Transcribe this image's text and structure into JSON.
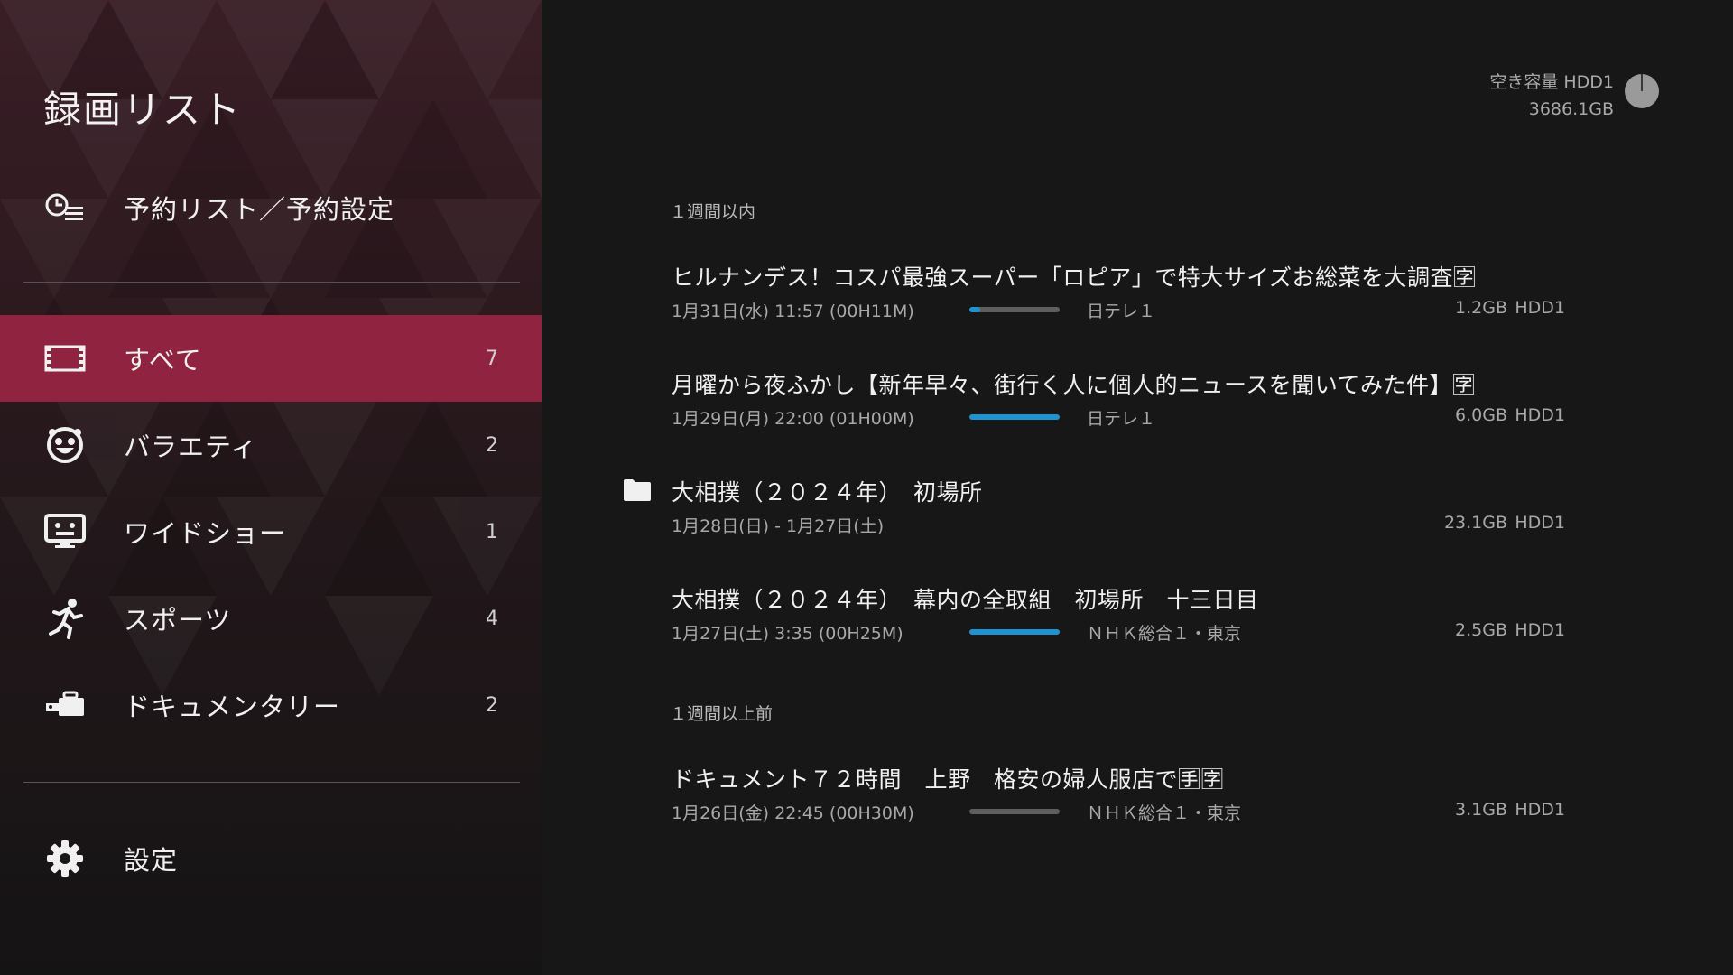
{
  "sidebar": {
    "title": "録画リスト",
    "schedule_label": "予約リスト／予約設定",
    "categories": [
      {
        "label": "すべて",
        "count": "7",
        "icon": "film-icon",
        "active": true
      },
      {
        "label": "バラエティ",
        "count": "2",
        "icon": "smiley-face-icon",
        "active": false
      },
      {
        "label": "ワイドショー",
        "count": "1",
        "icon": "tv-face-icon",
        "active": false
      },
      {
        "label": "スポーツ",
        "count": "4",
        "icon": "running-person-icon",
        "active": false
      },
      {
        "label": "ドキュメンタリー",
        "count": "2",
        "icon": "video-camera-icon",
        "active": false
      }
    ],
    "settings_label": "設定"
  },
  "storage": {
    "label": "空き容量 HDD1",
    "value": "3686.1GB"
  },
  "sections": [
    {
      "header": "１週間以内",
      "items": [
        {
          "title": "ヒルナンデス！コスパ最強スーパー「ロピア」で特大サイズお総菜を大調査🈑",
          "date": "1月31日(水) 11:57 (00H11M)",
          "progress": 0.12,
          "channel": "日テレ１",
          "size": "1.2GB",
          "drive": "HDD1",
          "folder": false
        },
        {
          "title": "月曜から夜ふかし【新年早々、街行く人に個人的ニュースを聞いてみた件】🈑",
          "date": "1月29日(月) 22:00 (01H00M)",
          "progress": 1.0,
          "channel": "日テレ１",
          "size": "6.0GB",
          "drive": "HDD1",
          "folder": false
        },
        {
          "title": "大相撲（２０２４年）　初場所",
          "date": "1月28日(日) - 1月27日(土)",
          "progress": null,
          "channel": "",
          "size": "23.1GB",
          "drive": "HDD1",
          "folder": true
        },
        {
          "title": "大相撲（２０２４年）　幕内の全取組　初場所　十三日目",
          "date": "1月27日(土) 3:35 (00H25M)",
          "progress": 1.0,
          "channel": "ＮＨＫ総合１・東京",
          "size": "2.5GB",
          "drive": "HDD1",
          "folder": false
        }
      ]
    },
    {
      "header": "１週間以上前",
      "items": [
        {
          "title": "ドキュメント７２時間　上野　格安の婦人服店で🈐🈑",
          "date": "1月26日(金) 22:45 (00H30M)",
          "progress": 0.0,
          "channel": "ＮＨＫ総合１・東京",
          "size": "3.1GB",
          "drive": "HDD1",
          "folder": false
        }
      ]
    }
  ],
  "colors": {
    "accent": "#8f2340",
    "progress": "#1e93d1",
    "background": "#171717"
  }
}
